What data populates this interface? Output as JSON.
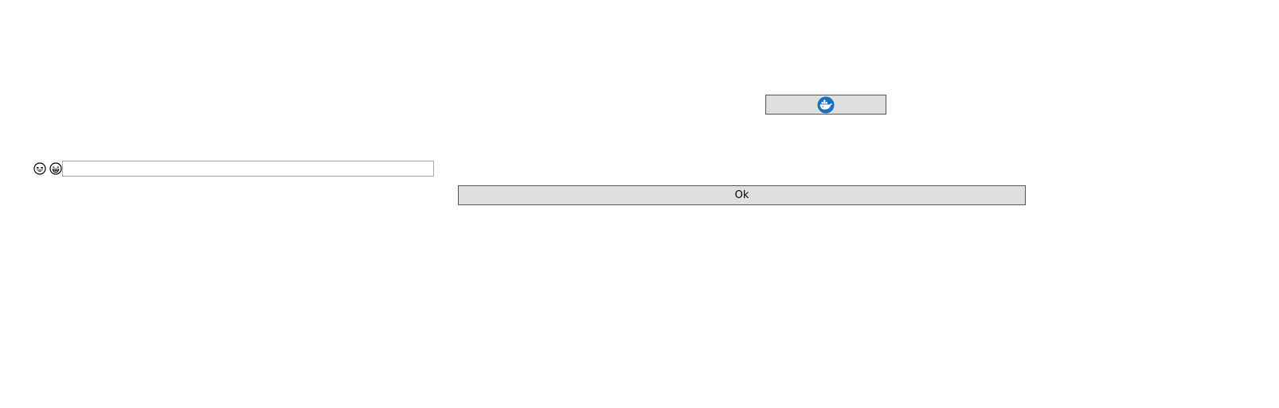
{
  "icons": {
    "emoji_left": "grinning-squinting-face-icon",
    "emoji_right": "beaming-face-icon",
    "button_icon": "whale-container-icon"
  },
  "text_input": {
    "value": "",
    "placeholder": ""
  },
  "ok_button": {
    "label": "Ok"
  },
  "colors": {
    "button_background": "#dfdfdf",
    "button_border": "#555555",
    "icon_blue": "#1a6fc0"
  }
}
